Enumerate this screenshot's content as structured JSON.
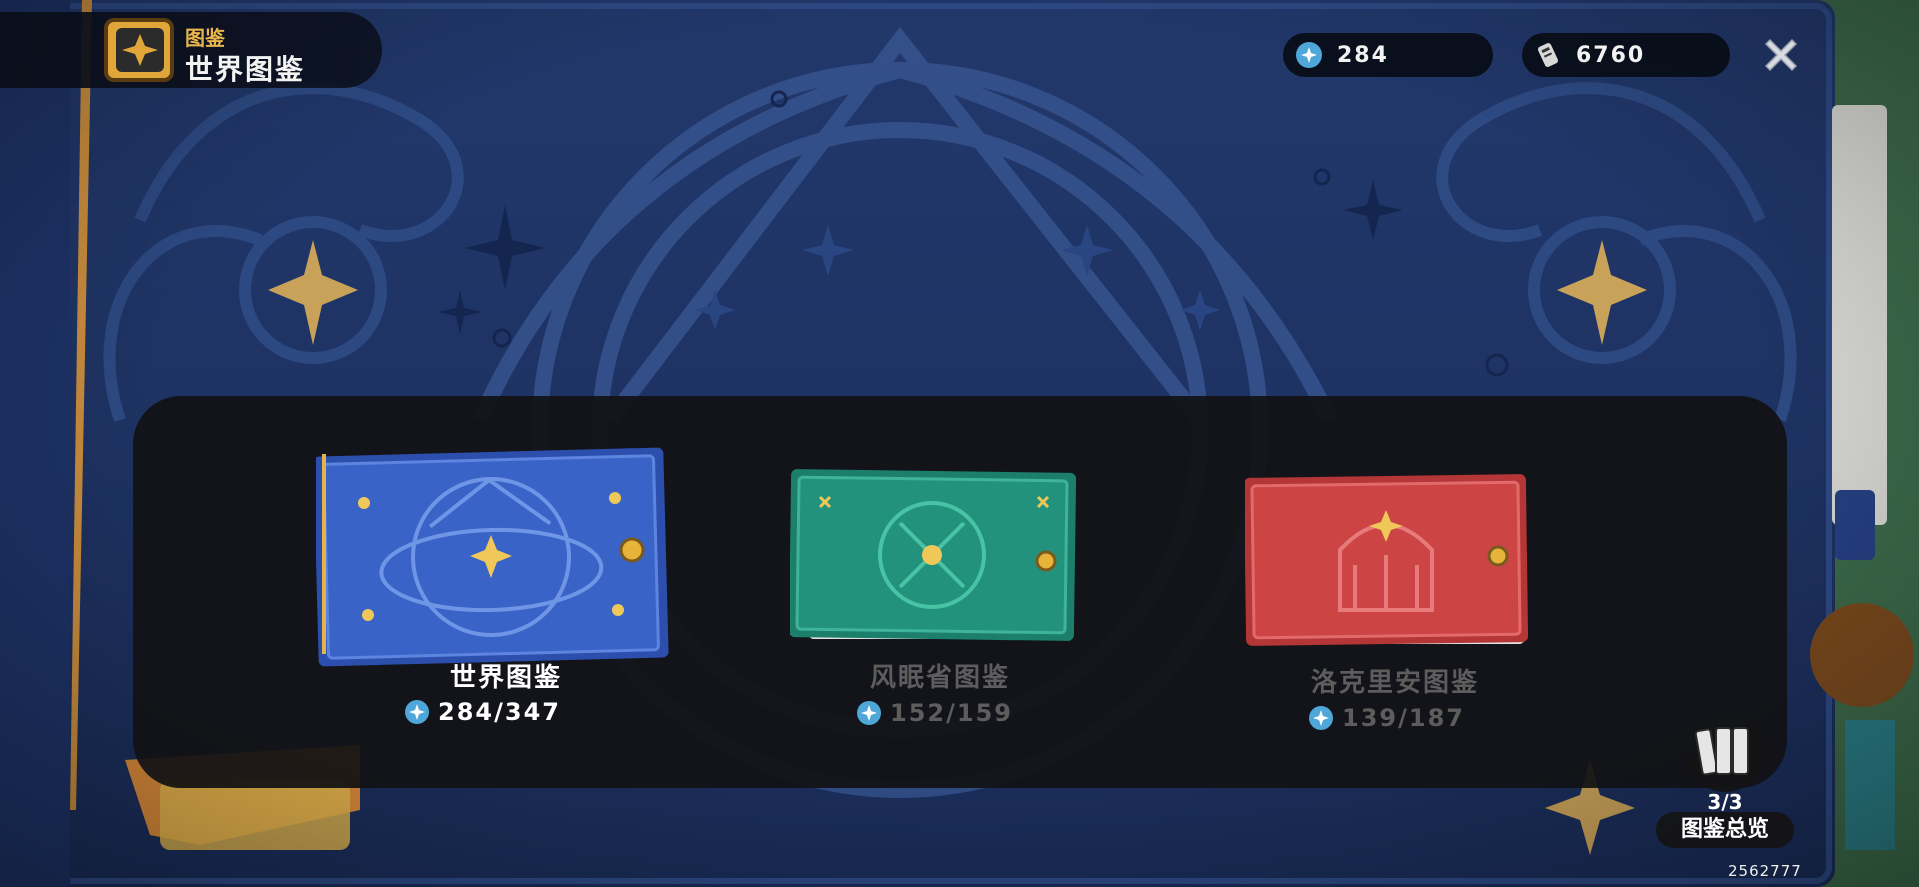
{
  "header": {
    "category_label": "图鉴",
    "title": "世界图鉴",
    "icon": "codex-book-icon"
  },
  "currencies": [
    {
      "icon": "star-token-icon",
      "value": "284",
      "color": "#4fa6d8"
    },
    {
      "icon": "ticket-pass-icon",
      "value": "6760",
      "color": "#d8d8d8"
    }
  ],
  "close_icon": "close-x-icon",
  "books": [
    {
      "name": "世界图鉴",
      "progress": "284/347",
      "theme": "blue",
      "cover_color": "#3560c4",
      "selected": true
    },
    {
      "name": "风眠省图鉴",
      "progress": "152/159",
      "theme": "green",
      "cover_color": "#1f8a78",
      "selected": false
    },
    {
      "name": "洛克里安图鉴",
      "progress": "139/187",
      "theme": "red",
      "cover_color": "#c43a3a",
      "selected": false
    }
  ],
  "overview": {
    "icon": "book-stack-icon",
    "count": "3/3",
    "label": "图鉴总览"
  },
  "uid": "2562777",
  "colors": {
    "background": "#1b2f5e",
    "band": "#121214",
    "accent_gold": "#e8b64a",
    "progress_star": "#4fa6d8"
  }
}
